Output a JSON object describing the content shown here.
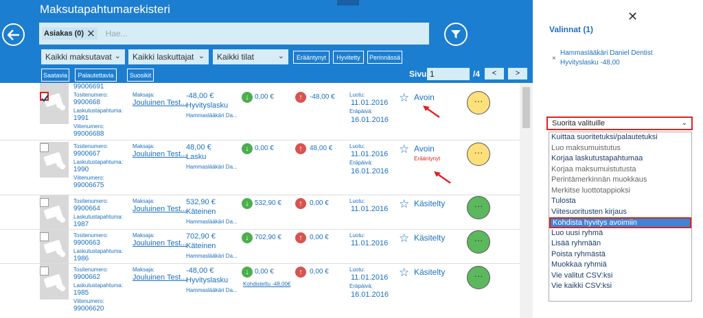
{
  "header": {
    "title": "Maksutapahtumarekisteri",
    "search_chip": "Asiakas (0)",
    "search_placeholder": "Hae...",
    "dropdowns": [
      "Kaikki maksutavat",
      "Kaikki laskuttajat",
      "Kaikki tilat"
    ],
    "toggle_buttons": [
      "Erääntynyt",
      "Hyvitetty",
      "Perinnässä",
      "Saatavia",
      "Palautettavia",
      "Suosikit"
    ],
    "page_label": "Sivu",
    "page_value": "1",
    "page_total": "/4",
    "prev_label": "<",
    "next_label": ">"
  },
  "labels": {
    "tositenumero": "Tositenumero:",
    "laskutustapahtuma": "Laskutustapahtuma:",
    "viitenumero": "Viitenumero:",
    "maksaja": "Maksaja:",
    "luotu": "Luotu:",
    "erapaiva": "Eräpäivä:",
    "dots": "···"
  },
  "rows": [
    {
      "top_ref": "99006691",
      "tositenumero": "9900668",
      "laskutustapahtuma": "1991",
      "viitenumero": "99006688",
      "maksaja": "Jouluinen Test...",
      "amount": "-48,00 €",
      "type": "Hyvityslasku",
      "biller": "Hammaslääkäri Da...",
      "paid": "0,00 €",
      "open": "-48,00 €",
      "luotu": "11.01.2016",
      "erapaiva": "16.01.2016",
      "status": "Avoin",
      "status_note": "",
      "checked": true
    },
    {
      "tositenumero": "9900667",
      "laskutustapahtuma": "1990",
      "viitenumero": "99006675",
      "maksaja": "Jouluinen Test...",
      "amount": "48,00 €",
      "type": "Lasku",
      "biller": "Hammaslääkäri Da...",
      "paid": "0,00 €",
      "open": "48,00 €",
      "luotu": "11.01.2016",
      "erapaiva": "16.01.2016",
      "status": "Avoin",
      "status_note": "Erääntynyt",
      "checked": false
    },
    {
      "tositenumero": "9900664",
      "laskutustapahtuma": "1987",
      "maksaja": "Jouluinen Test...",
      "amount": "532,90 €",
      "type": "Käteinen",
      "biller": "Hammaslääkäri Da...",
      "paid": "532,90 €",
      "open": "0,00 €",
      "luotu": "11.01.2016",
      "status": "Käsitelty",
      "checked": false
    },
    {
      "tositenumero": "9900663",
      "laskutustapahtuma": "1986",
      "maksaja": "Jouluinen Test...",
      "amount": "702,90 €",
      "type": "Käteinen",
      "biller": "Hammaslääkäri Da...",
      "paid": "702,90 €",
      "open": "0,00 €",
      "luotu": "11.01.2016",
      "status": "Käsitelty",
      "checked": false
    },
    {
      "tositenumero": "9900662",
      "laskutustapahtuma": "1985",
      "viitenumero": "99006620",
      "maksaja": "Jouluinen Test...",
      "amount": "-48,00 €",
      "type": "Hyvityslasku",
      "biller": "Hammaslääkäri Da...",
      "paid": "0,00 €",
      "paid_note": "Kohdistettu -48,00€",
      "open": "0,00 €",
      "luotu": "11.01.2016",
      "erapaiva": "16.01.2016",
      "status": "Käsitelty",
      "checked": false
    }
  ],
  "panel": {
    "title": "Valinnat (1)",
    "selection_line1": "Hammaslääkäri Daniel Dentist",
    "selection_line2": "Hyvityslasku -48,00",
    "action_select": "Suorita valituille",
    "actions": [
      "Kuittaa suoritetuksi/palautetuksi",
      "Luo maksumuistutus",
      "Korjaa laskutustapahtumaa",
      "Korjaa maksumuistutusta",
      "Perintämerkinnän muokkaus",
      "Merkitse luottotappioksi",
      "Tulosta",
      "Viitesuoritusten kirjaus",
      "Kohdista hyvitys avoimiin",
      "Luo uusi ryhmä",
      "Lisää ryhmään",
      "Poista ryhmästä",
      "Muokkaa ryhmiä",
      "Vie valitut CSV:ksi",
      "Vie kaikki CSV:ksi"
    ]
  }
}
